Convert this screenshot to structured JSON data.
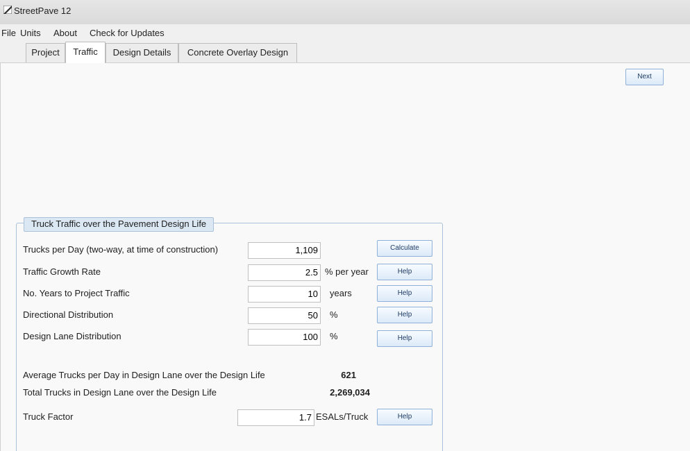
{
  "app": {
    "title": "StreetPave 12",
    "icon": "streetpave-logo-icon"
  },
  "menu": {
    "items": [
      "File",
      "Units",
      "About",
      "Check for Updates"
    ]
  },
  "tabs": [
    {
      "label": "Project",
      "active": false
    },
    {
      "label": "Traffic",
      "active": true
    },
    {
      "label": "Design Details",
      "active": false
    },
    {
      "label": "Concrete Overlay Design",
      "active": false
    }
  ],
  "toolbar": {
    "next_label": "Next"
  },
  "truck_traffic": {
    "title": "Truck Traffic over the Pavement Design Life",
    "rows": [
      {
        "label": "Trucks per Day (two-way, at time of construction)",
        "value": "1,109",
        "unit": "",
        "button": "Calculate"
      },
      {
        "label": "Traffic Growth Rate",
        "value": "2.5",
        "unit": "% per year",
        "button": "Help"
      },
      {
        "label": "No. Years to Project Traffic",
        "value": "10",
        "unit": "years",
        "button": "Help"
      },
      {
        "label": "Directional Distribution",
        "value": "50",
        "unit": "%",
        "button": "Help"
      },
      {
        "label": "Design Lane Distribution",
        "value": "100",
        "unit": "%",
        "button": "Help"
      }
    ],
    "results": [
      {
        "label": "Average Trucks per Day in Design Lane over the Design Life",
        "value": "621"
      },
      {
        "label": "Total Trucks in Design Lane over the Design Life",
        "value": "2,269,034"
      }
    ],
    "truck_factor": {
      "label": "Truck Factor",
      "value": "1.7",
      "unit": "ESALs/Truck",
      "button": "Help"
    }
  },
  "colors": {
    "accent_border": "#8fb0d8",
    "group_header": "#dbe7f3"
  }
}
